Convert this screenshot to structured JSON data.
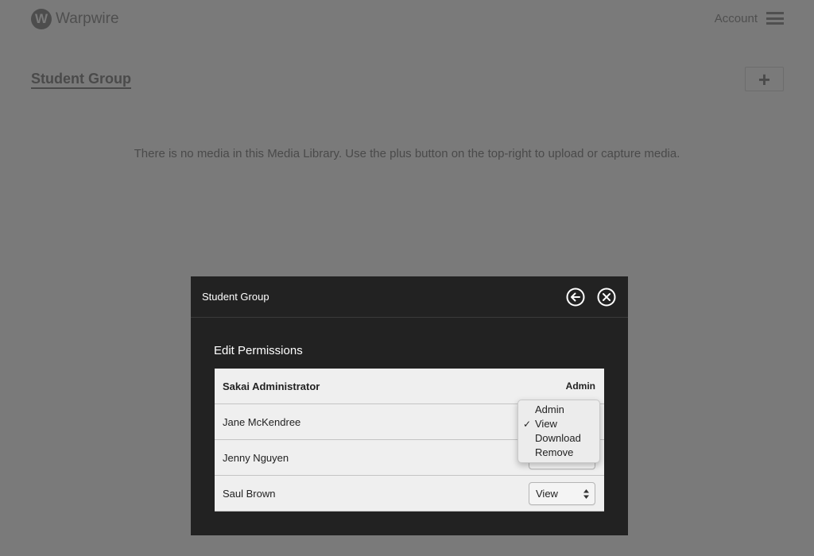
{
  "app": {
    "brand": "Warpwire",
    "logo_letter": "W",
    "account_label": "Account"
  },
  "library": {
    "title": "Student Group",
    "add_button_label": "+",
    "empty_message": "There is no media in this Media Library. Use the plus button on the top-right to upload or capture media."
  },
  "modal": {
    "title": "Student Group",
    "section_title": "Edit Permissions",
    "rows": [
      {
        "name": "Sakai Administrator",
        "role": "Admin",
        "editable": false
      },
      {
        "name": "Jane McKendree",
        "role": "View",
        "editable": true
      },
      {
        "name": "Jenny Nguyen",
        "role": "View",
        "editable": true
      },
      {
        "name": "Saul Brown",
        "role": "View",
        "editable": true
      }
    ],
    "dropdown": {
      "open_for_row": "Jane McKendree",
      "options": [
        "Admin",
        "View",
        "Download",
        "Remove"
      ],
      "selected": "View",
      "check_mark": "✓"
    }
  },
  "colors": {
    "overlay_bg": "#7a7a7a",
    "modal_bg": "#222222",
    "table_bg": "#efefef"
  }
}
